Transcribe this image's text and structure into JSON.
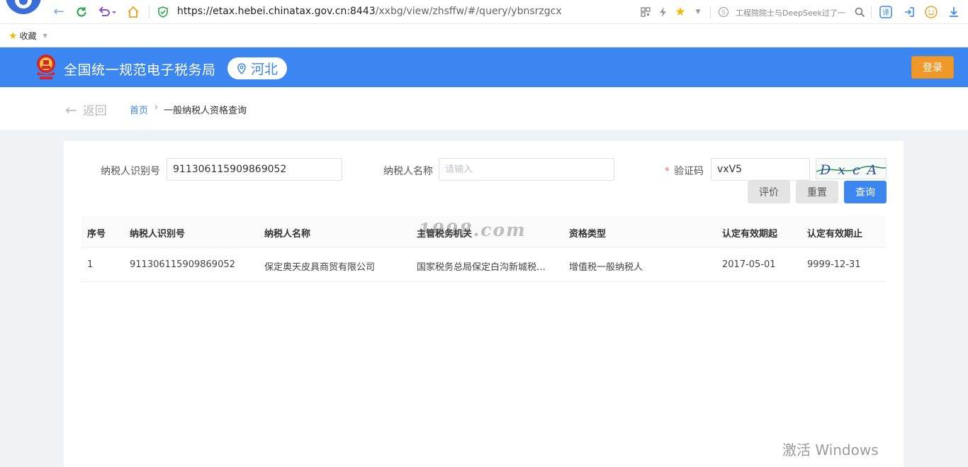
{
  "browser": {
    "url_host": "https://etax.hebei.chinatax.gov.cn:8443",
    "url_path": "/xxbg/view/zhsffw/#/query/ybnsrzgcx",
    "search_text": "工程院院士与DeepSeek过了一",
    "bookmark_label": "收藏"
  },
  "header": {
    "site_title": "全国统一规范电子税务局",
    "region": "河北",
    "login_label": "登录",
    "accent_color": "#3b86f0",
    "login_color": "#f0982a"
  },
  "breadcrumb": {
    "back_label": "返回",
    "home": "首页",
    "separator": "›",
    "current": "一般纳税人资格查询"
  },
  "form": {
    "taxpayer_id_label": "纳税人识别号",
    "taxpayer_id_value": "911306115909869052",
    "taxpayer_name_label": "纳税人名称",
    "taxpayer_name_placeholder": "请输入",
    "captcha_label": "验证码",
    "captcha_value": "vxV5",
    "captcha_image_text": "DxcA",
    "evaluate_label": "评价",
    "reset_label": "重置",
    "query_label": "查询"
  },
  "table": {
    "headers": [
      "序号",
      "纳税人识别号",
      "纳税人名称",
      "主管税务机关",
      "资格类型",
      "认定有效期起",
      "认定有效期止"
    ],
    "rows": [
      [
        "1",
        "911306115909869052",
        "保定奥天皮具商贸有限公司",
        "国家税务总局保定白沟新城税…",
        "增值税一般纳税人",
        "2017-05-01",
        "9999-12-31"
      ]
    ]
  },
  "overlay": {
    "site_watermark": "1998.com",
    "windows_activation": "激活 Windows"
  }
}
